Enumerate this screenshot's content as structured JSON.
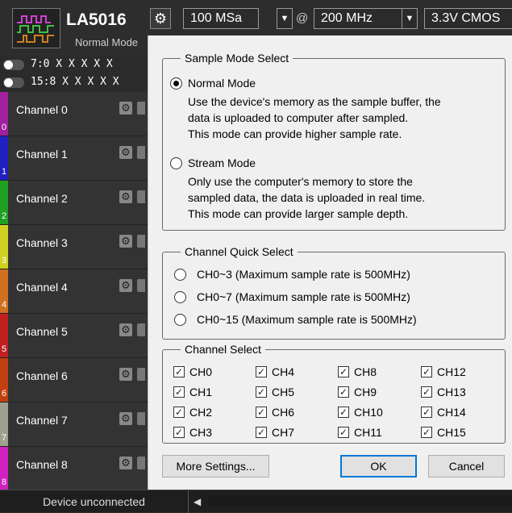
{
  "toolbar": {
    "device_name": "LA5016",
    "device_mode": "Normal Mode",
    "sample_count": "100 MSa",
    "at": "@",
    "sample_rate": "200 MHz",
    "voltage": "3.3V CMOS"
  },
  "triggers": [
    {
      "label": "7:0  X X X X X"
    },
    {
      "label": "15:8 X X X X X"
    }
  ],
  "channels": [
    {
      "name": "Channel 0",
      "index": "0",
      "color": "#a020a0"
    },
    {
      "name": "Channel 1",
      "index": "1",
      "color": "#2020c0"
    },
    {
      "name": "Channel 2",
      "index": "2",
      "color": "#20a020"
    },
    {
      "name": "Channel 3",
      "index": "3",
      "color": "#d0d020"
    },
    {
      "name": "Channel 4",
      "index": "4",
      "color": "#d07020"
    },
    {
      "name": "Channel 5",
      "index": "5",
      "color": "#c02020"
    },
    {
      "name": "Channel 6",
      "index": "6",
      "color": "#c04010"
    },
    {
      "name": "Channel 7",
      "index": "7",
      "color": "#a0a090"
    },
    {
      "name": "Channel 8",
      "index": "8",
      "color": "#d020c0"
    }
  ],
  "status": {
    "text": "Device unconnected"
  },
  "dialog": {
    "sample_mode": {
      "title": "Sample Mode Select",
      "normal_label": "Normal Mode",
      "normal_desc": [
        "Use the device's memory as the sample buffer, the",
        "data is uploaded to computer after sampled.",
        "This mode can provide higher sample rate."
      ],
      "stream_label": "Stream Mode",
      "stream_desc": [
        "Only use the computer's memory to store the",
        "sampled data, the data is uploaded in real time.",
        "This mode can provide larger sample depth."
      ]
    },
    "quick_select": {
      "title": "Channel Quick Select",
      "options": [
        "CH0~3 (Maximum sample rate is 500MHz)",
        "CH0~7 (Maximum sample rate is 500MHz)",
        "CH0~15 (Maximum sample rate is 500MHz)"
      ]
    },
    "channel_select": {
      "title": "Channel Select",
      "channels": [
        "CH0",
        "CH4",
        "CH8",
        "CH12",
        "CH1",
        "CH5",
        "CH9",
        "CH13",
        "CH2",
        "CH6",
        "CH10",
        "CH14",
        "CH3",
        "CH7",
        "CH11",
        "CH15"
      ],
      "check_mark": "✓"
    },
    "buttons": {
      "more": "More Settings...",
      "ok": "OK",
      "cancel": "Cancel"
    }
  }
}
